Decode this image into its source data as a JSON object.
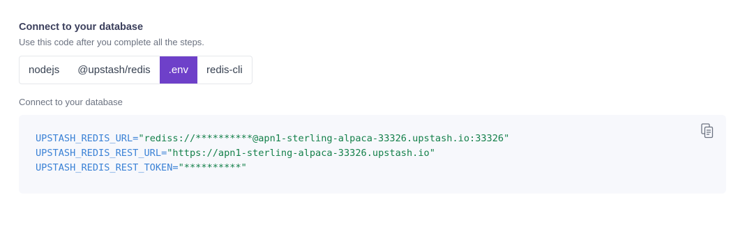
{
  "header": {
    "title": "Connect to your database",
    "subtitle": "Use this code after you complete all the steps."
  },
  "tabs": [
    {
      "label": "nodejs",
      "active": false
    },
    {
      "label": "@upstash/redis",
      "active": false
    },
    {
      "label": ".env",
      "active": true
    },
    {
      "label": "redis-cli",
      "active": false
    }
  ],
  "section": {
    "label": "Connect to your database"
  },
  "code": {
    "lines": [
      {
        "key": "UPSTASH_REDIS_URL",
        "eq": "=",
        "value": "\"rediss://**********@apn1-sterling-alpaca-33326.upstash.io:33326\""
      },
      {
        "key": "UPSTASH_REDIS_REST_URL",
        "eq": "=",
        "value": "\"https://apn1-sterling-alpaca-33326.upstash.io\""
      },
      {
        "key": "UPSTASH_REDIS_REST_TOKEN",
        "eq": "=",
        "value": "\"**********\""
      }
    ],
    "copy_icon": "copy-icon"
  },
  "colors": {
    "accent": "#6e40c9",
    "code_key": "#3b82d6",
    "code_value": "#14804a",
    "code_bg": "#f7f8fc"
  }
}
